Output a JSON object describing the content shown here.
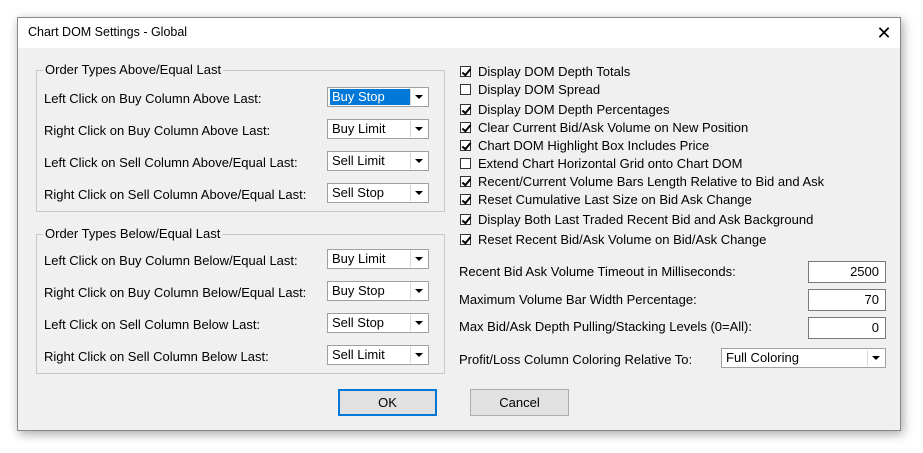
{
  "window": {
    "title": "Chart DOM Settings - Global",
    "close_glyph": "✕"
  },
  "above_group": {
    "label": "Order Types Above/Equal Last",
    "rows": [
      {
        "label": "Left Click on Buy Column Above Last:",
        "value": "Buy Stop"
      },
      {
        "label": "Right Click on Buy Column Above Last:",
        "value": "Buy Limit"
      },
      {
        "label": "Left Click on Sell Column Above/Equal Last:",
        "value": "Sell Limit"
      },
      {
        "label": "Right Click on Sell Column Above/Equal Last:",
        "value": "Sell Stop"
      }
    ]
  },
  "below_group": {
    "label": "Order Types Below/Equal Last",
    "rows": [
      {
        "label": "Left Click on Buy Column Below/Equal Last:",
        "value": "Buy Limit"
      },
      {
        "label": "Right Click on Buy Column Below/Equal Last:",
        "value": "Buy Stop"
      },
      {
        "label": "Left Click on Sell Column Below Last:",
        "value": "Sell Stop"
      },
      {
        "label": "Right Click on Sell Column Below Last:",
        "value": "Sell Limit"
      }
    ]
  },
  "checkboxes": [
    {
      "label": "Display DOM Depth Totals",
      "checked": true
    },
    {
      "label": "Display DOM Spread",
      "checked": false
    },
    {
      "label": "Display DOM Depth Percentages",
      "checked": true
    },
    {
      "label": "Clear Current Bid/Ask Volume on New Position",
      "checked": true
    },
    {
      "label": "Chart DOM Highlight Box Includes Price",
      "checked": true
    },
    {
      "label": "Extend Chart Horizontal Grid onto Chart DOM",
      "checked": false
    },
    {
      "label": "Recent/Current Volume Bars Length Relative to Bid and Ask",
      "checked": true
    },
    {
      "label": "Reset Cumulative Last Size on Bid Ask Change",
      "checked": true
    },
    {
      "label": "Display Both Last Traded Recent Bid and Ask Background",
      "checked": true
    },
    {
      "label": "Reset Recent Bid/Ask Volume on Bid/Ask Change",
      "checked": true
    }
  ],
  "numeric": [
    {
      "label": "Recent Bid Ask Volume Timeout in Milliseconds:",
      "value": "2500"
    },
    {
      "label": "Maximum Volume Bar Width Percentage:",
      "value": "70"
    },
    {
      "label": "Max Bid/Ask Depth Pulling/Stacking Levels (0=All):",
      "value": "0"
    }
  ],
  "pl_coloring": {
    "label": "Profit/Loss Column Coloring Relative To:",
    "value": "Full Coloring"
  },
  "buttons": {
    "ok": "OK",
    "cancel": "Cancel"
  }
}
